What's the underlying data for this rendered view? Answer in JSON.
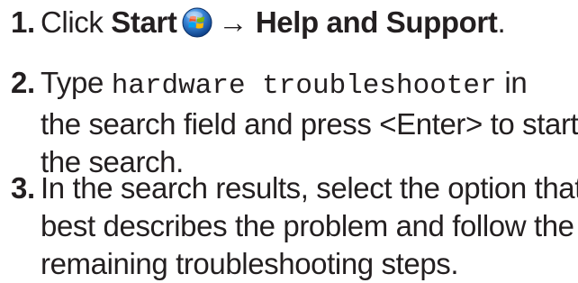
{
  "steps": [
    {
      "number": "1.",
      "pre": "Click ",
      "start_label": "Start",
      "arrow": "→",
      "help_label": "Help and Support",
      "period": "."
    },
    {
      "number": "2.",
      "type_label": "Type",
      "query": "hardware troubleshooter",
      "in_label": "in",
      "line2": "the search field and press <Enter> to start",
      "line3": "the search."
    },
    {
      "number": "3.",
      "line1": "In the search results, select the option that",
      "line2": "best describes the problem and follow the",
      "line3": "remaining troubleshooting steps."
    }
  ],
  "icons": {
    "start_orb": "windows-start-orb-icon"
  },
  "colors": {
    "text": "#231f20",
    "orb_blue": "#2a6fc9"
  }
}
